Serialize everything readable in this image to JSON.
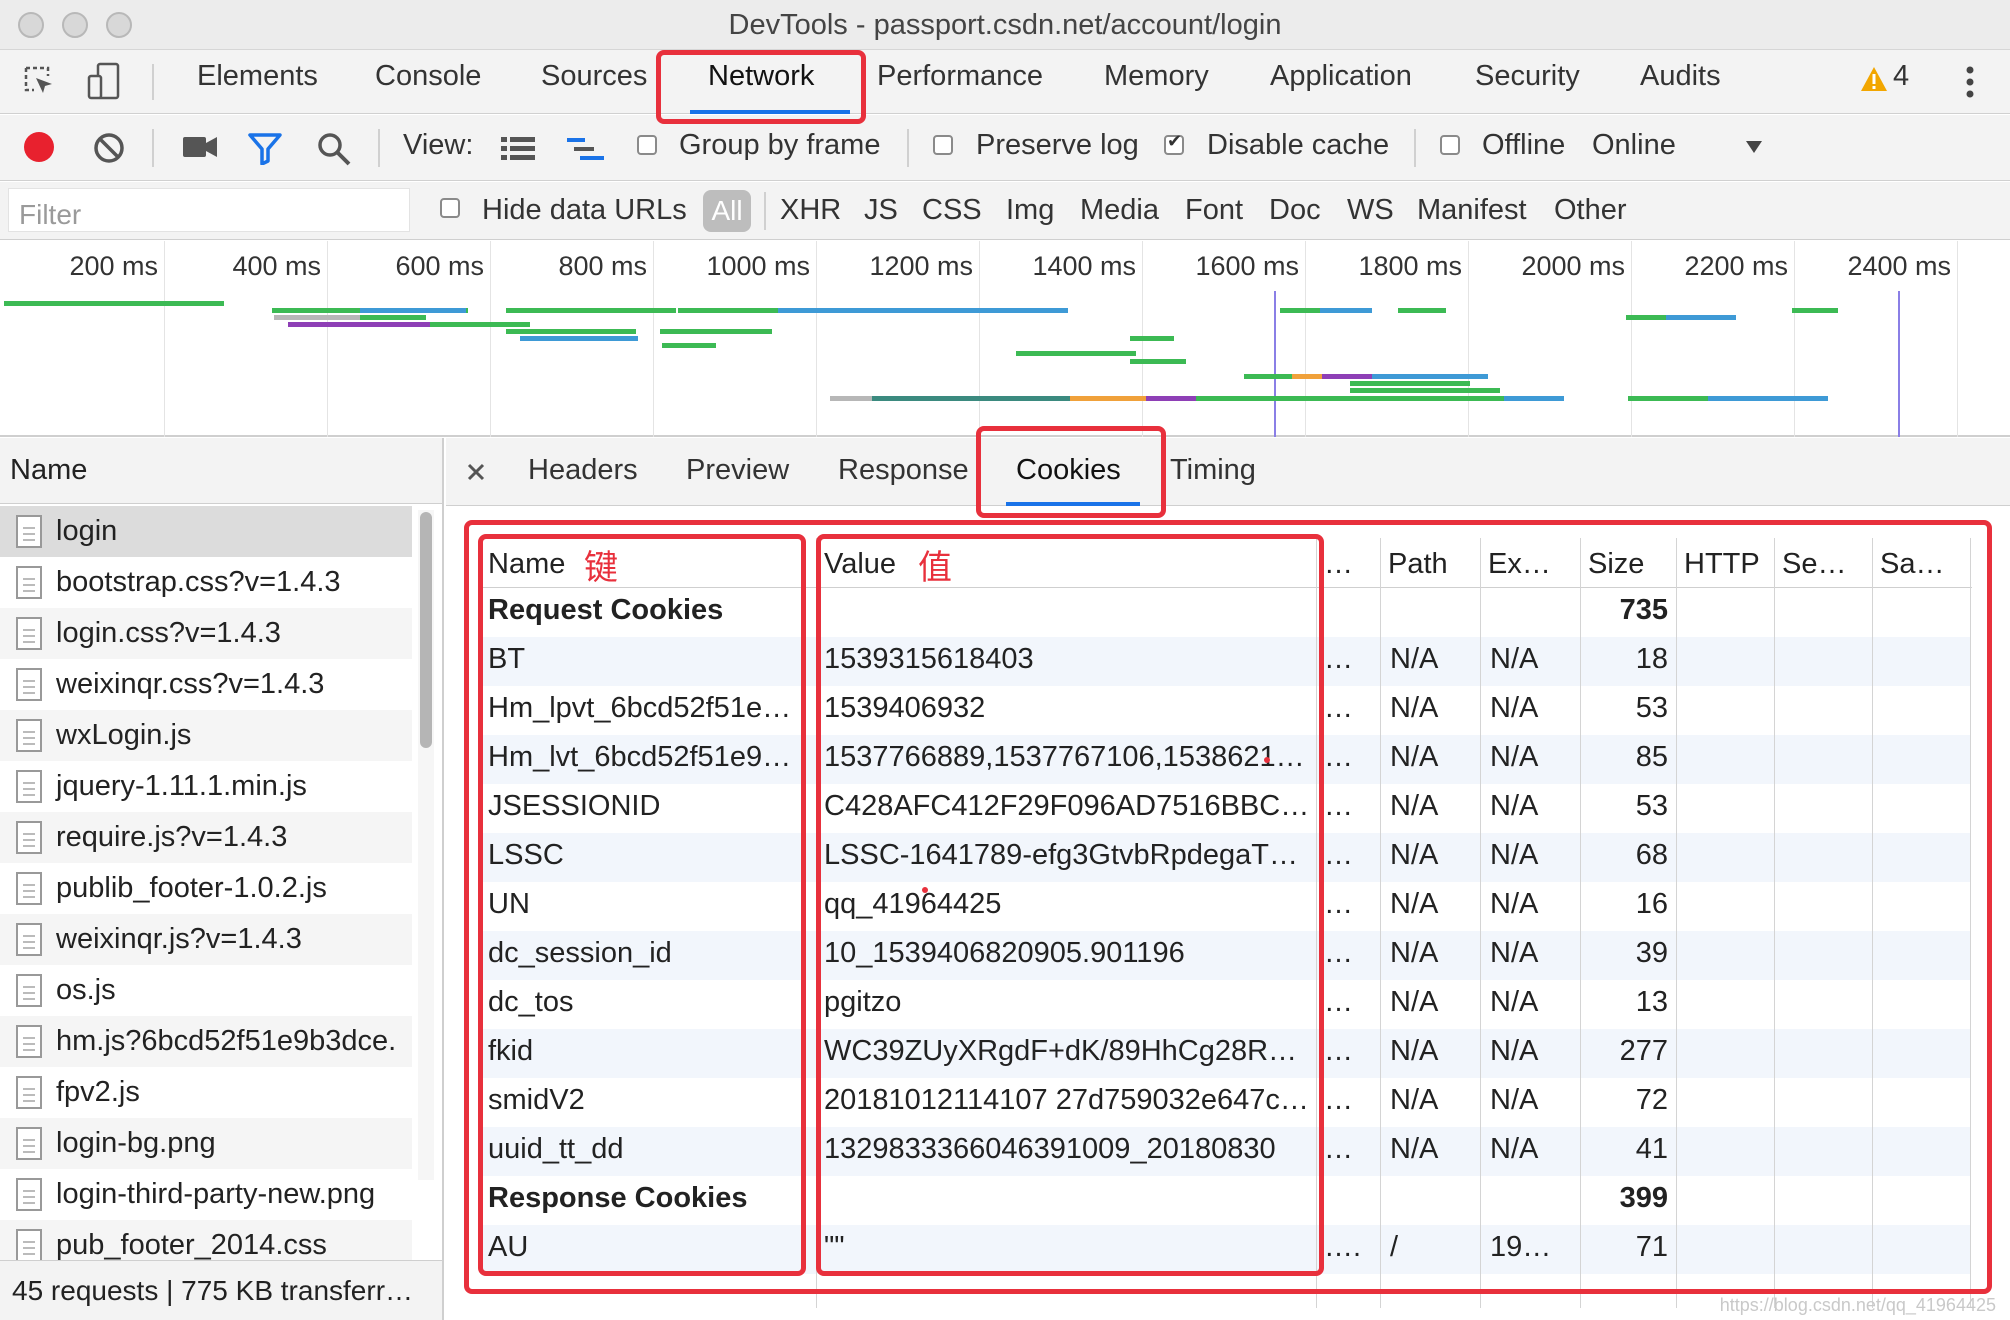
{
  "window": {
    "title": "DevTools - passport.csdn.net/account/login"
  },
  "main_tabs": [
    "Elements",
    "Console",
    "Sources",
    "Network",
    "Performance",
    "Memory",
    "Application",
    "Security",
    "Audits"
  ],
  "warnings": {
    "count": "4"
  },
  "toolbar": {
    "view_label": "View:",
    "group_by_frame": "Group by frame",
    "preserve_log": "Preserve log",
    "disable_cache": "Disable cache",
    "offline": "Offline",
    "throttle": "Online"
  },
  "filter": {
    "placeholder": "Filter",
    "hide_data_urls": "Hide data URLs",
    "types": [
      "All",
      "XHR",
      "JS",
      "CSS",
      "Img",
      "Media",
      "Font",
      "Doc",
      "WS",
      "Manifest",
      "Other"
    ]
  },
  "overview": {
    "ticks": [
      "200 ms",
      "400 ms",
      "600 ms",
      "800 ms",
      "1000 ms",
      "1200 ms",
      "1400 ms",
      "1600 ms",
      "1800 ms",
      "2000 ms",
      "2200 ms",
      "2400 ms"
    ]
  },
  "requests": {
    "header": "Name",
    "items": [
      "login",
      "bootstrap.css?v=1.4.3",
      "login.css?v=1.4.3",
      "weixinqr.css?v=1.4.3",
      "wxLogin.js",
      "jquery-1.11.1.min.js",
      "require.js?v=1.4.3",
      "publib_footer-1.0.2.js",
      "weixinqr.js?v=1.4.3",
      "os.js",
      "hm.js?6bcd52f51e9b3dce.",
      "fpv2.js",
      "login-bg.png",
      "login-third-party-new.png",
      "pub_footer_2014.css"
    ],
    "status": "45 requests | 775 KB transferr…"
  },
  "detail_tabs": [
    "Headers",
    "Preview",
    "Response",
    "Cookies",
    "Timing"
  ],
  "cookies": {
    "columns": [
      "Name",
      "Value",
      "…",
      "Path",
      "Ex…",
      "Size",
      "HTTP",
      "Se…",
      "Sa…"
    ],
    "rows": [
      {
        "name": "Request Cookies",
        "value": "",
        "dom": "",
        "path": "",
        "expires": "",
        "size": "735",
        "section": true
      },
      {
        "name": "BT",
        "value": "1539315618403",
        "dom": "…",
        "path": "N/A",
        "expires": "N/A",
        "size": "18"
      },
      {
        "name": "Hm_lpvt_6bcd52f51e…",
        "value": "1539406932",
        "dom": "…",
        "path": "N/A",
        "expires": "N/A",
        "size": "53"
      },
      {
        "name": "Hm_lvt_6bcd52f51e9…",
        "value": "1537766889,1537767106,1538621…",
        "dom": "…",
        "path": "N/A",
        "expires": "N/A",
        "size": "85"
      },
      {
        "name": "JSESSIONID",
        "value": "C428AFC412F29F096AD7516BBC…",
        "dom": "…",
        "path": "N/A",
        "expires": "N/A",
        "size": "53"
      },
      {
        "name": "LSSC",
        "value": "LSSC-1641789-efg3GtvbRpdegaT…",
        "dom": "…",
        "path": "N/A",
        "expires": "N/A",
        "size": "68"
      },
      {
        "name": "UN",
        "value": "qq_41964425",
        "dom": "…",
        "path": "N/A",
        "expires": "N/A",
        "size": "16"
      },
      {
        "name": "dc_session_id",
        "value": "10_1539406820905.901196",
        "dom": "…",
        "path": "N/A",
        "expires": "N/A",
        "size": "39"
      },
      {
        "name": "dc_tos",
        "value": "pgitzo",
        "dom": "…",
        "path": "N/A",
        "expires": "N/A",
        "size": "13"
      },
      {
        "name": "fkid",
        "value": "WC39ZUyXRgdF+dK/89HhCg28R…",
        "dom": "…",
        "path": "N/A",
        "expires": "N/A",
        "size": "277"
      },
      {
        "name": "smidV2",
        "value": "20181012114107 27d759032e647c…",
        "dom": "…",
        "path": "N/A",
        "expires": "N/A",
        "size": "72"
      },
      {
        "name": "uuid_tt_dd",
        "value": "1329833366046391009_20180830",
        "dom": "…",
        "path": "N/A",
        "expires": "N/A",
        "size": "41"
      },
      {
        "name": "Response Cookies",
        "value": "",
        "dom": "",
        "path": "",
        "expires": "",
        "size": "399",
        "section": true
      },
      {
        "name": "AU",
        "value": "\"\"",
        "dom": "….",
        "path": "/",
        "expires": "19…",
        "size": "71"
      }
    ]
  },
  "annotations": {
    "key": "键",
    "value": "值"
  },
  "watermark": "https://blog.csdn.net/qq_41964425",
  "colors": {
    "annotation_red": "#e8303c",
    "record_red": "#e8212e",
    "accent_blue": "#1a73e8",
    "zebra": "#f2f6fc"
  }
}
